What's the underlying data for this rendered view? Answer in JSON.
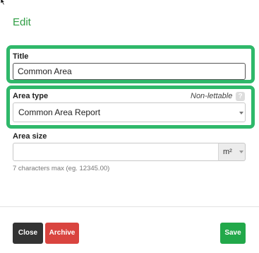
{
  "dialog": {
    "heading": "Edit"
  },
  "fields": {
    "title": {
      "label": "Title",
      "value": "Common Area"
    },
    "area_type": {
      "label": "Area type",
      "status": "Non-lettable",
      "help": "?",
      "selected": "Common Area Report"
    },
    "area_size": {
      "label": "Area size",
      "value": "",
      "unit": "m²",
      "hint": "7 characters max (eg. 12345.00)"
    }
  },
  "buttons": {
    "close": "Close",
    "archive": "Archive",
    "save": "Save"
  },
  "colors": {
    "accent_green": "#2fb86a",
    "heading_green": "#2f9e44",
    "close_bg": "#333333",
    "archive_bg": "#d9443f",
    "save_bg": "#22a84a"
  },
  "icons": {
    "cursor": "mouse-pointer-icon",
    "dropdown": "chevron-down-icon",
    "help": "help-icon"
  }
}
